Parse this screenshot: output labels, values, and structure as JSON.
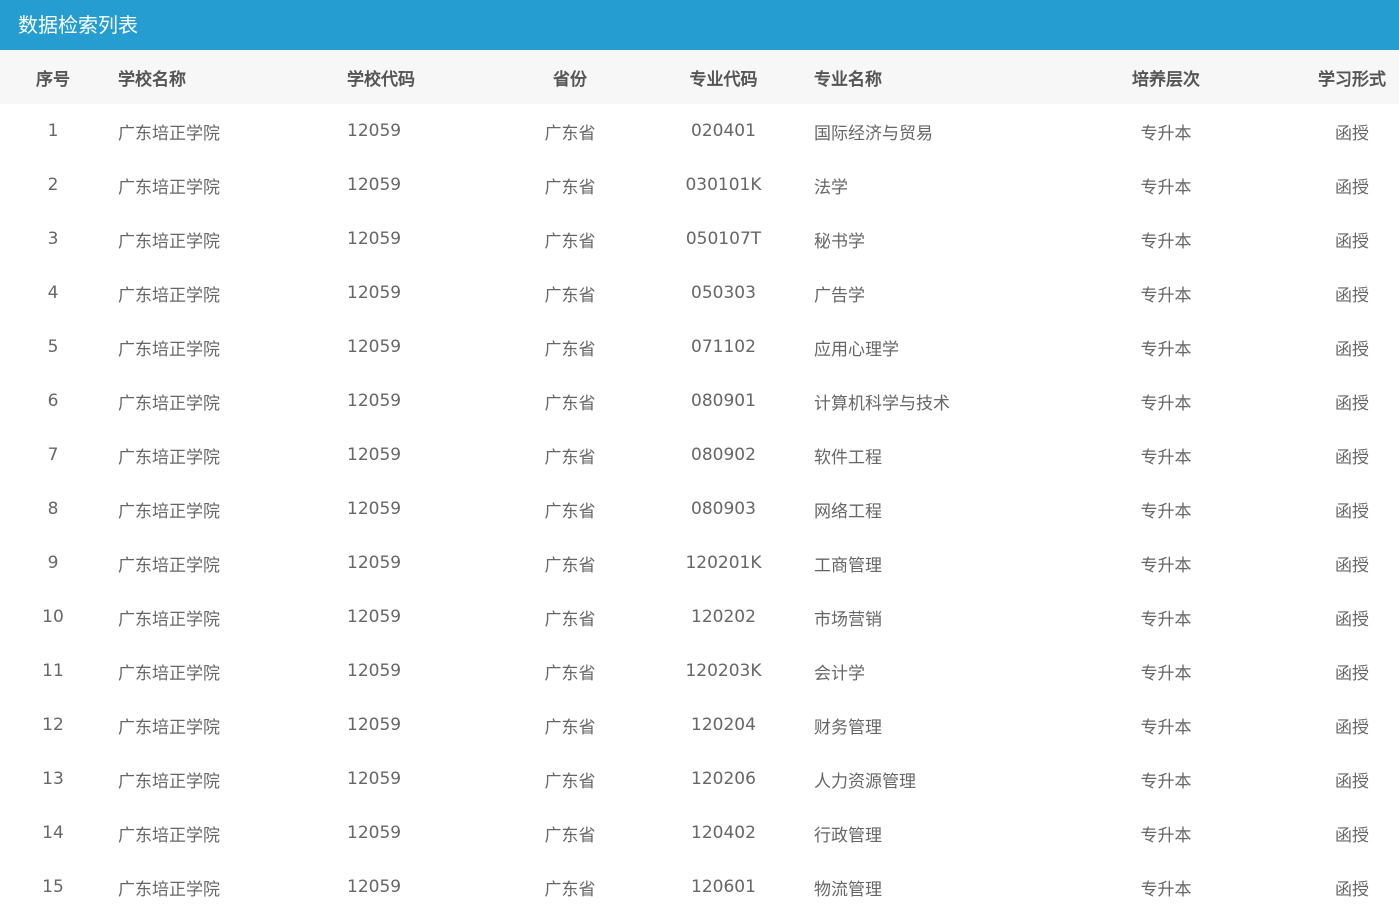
{
  "header": {
    "title": "数据检索列表"
  },
  "table": {
    "columns": [
      "序号",
      "学校名称",
      "学校代码",
      "省份",
      "专业代码",
      "专业名称",
      "培养层次",
      "学习形式"
    ],
    "rows": [
      [
        "1",
        "广东培正学院",
        "12059",
        "广东省",
        "020401",
        "国际经济与贸易",
        "专升本",
        "函授"
      ],
      [
        "2",
        "广东培正学院",
        "12059",
        "广东省",
        "030101K",
        "法学",
        "专升本",
        "函授"
      ],
      [
        "3",
        "广东培正学院",
        "12059",
        "广东省",
        "050107T",
        "秘书学",
        "专升本",
        "函授"
      ],
      [
        "4",
        "广东培正学院",
        "12059",
        "广东省",
        "050303",
        "广告学",
        "专升本",
        "函授"
      ],
      [
        "5",
        "广东培正学院",
        "12059",
        "广东省",
        "071102",
        "应用心理学",
        "专升本",
        "函授"
      ],
      [
        "6",
        "广东培正学院",
        "12059",
        "广东省",
        "080901",
        "计算机科学与技术",
        "专升本",
        "函授"
      ],
      [
        "7",
        "广东培正学院",
        "12059",
        "广东省",
        "080902",
        "软件工程",
        "专升本",
        "函授"
      ],
      [
        "8",
        "广东培正学院",
        "12059",
        "广东省",
        "080903",
        "网络工程",
        "专升本",
        "函授"
      ],
      [
        "9",
        "广东培正学院",
        "12059",
        "广东省",
        "120201K",
        "工商管理",
        "专升本",
        "函授"
      ],
      [
        "10",
        "广东培正学院",
        "12059",
        "广东省",
        "120202",
        "市场营销",
        "专升本",
        "函授"
      ],
      [
        "11",
        "广东培正学院",
        "12059",
        "广东省",
        "120203K",
        "会计学",
        "专升本",
        "函授"
      ],
      [
        "12",
        "广东培正学院",
        "12059",
        "广东省",
        "120204",
        "财务管理",
        "专升本",
        "函授"
      ],
      [
        "13",
        "广东培正学院",
        "12059",
        "广东省",
        "120206",
        "人力资源管理",
        "专升本",
        "函授"
      ],
      [
        "14",
        "广东培正学院",
        "12059",
        "广东省",
        "120402",
        "行政管理",
        "专升本",
        "函授"
      ],
      [
        "15",
        "广东培正学院",
        "12059",
        "广东省",
        "120601",
        "物流管理",
        "专升本",
        "函授"
      ]
    ]
  }
}
